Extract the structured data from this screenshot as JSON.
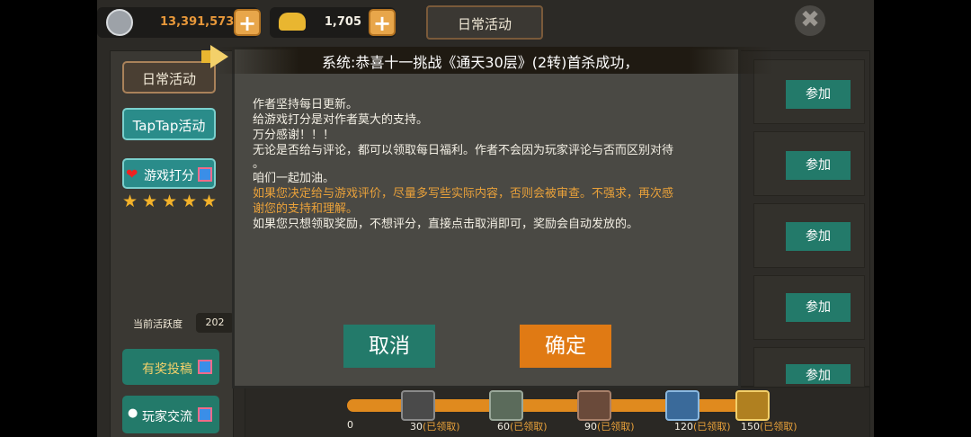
{
  "top_bar": {
    "silver": "13,391,573",
    "gold": "1,705",
    "tab_title": "日常活动",
    "plus_label": "+",
    "close_label": "✖"
  },
  "sidebar": {
    "daily": "日常活动",
    "taptap": "TapTap活动",
    "rate": "游戏打分",
    "stars": 5,
    "activity_label": "当前活跃度",
    "activity_value": "202",
    "submit": "有奖投稿",
    "community": "玩家交流"
  },
  "list": {
    "join_label": "参加"
  },
  "banner": {
    "text": "系统:恭喜十一挑战《通天30层》(2转)首杀成功，"
  },
  "dialog": {
    "lines": [
      "作者坚持每日更新。",
      "给游戏打分是对作者莫大的支持。",
      "万分感谢！！！",
      "无论是否给与评论，都可以领取每日福利。作者不会因为玩家评论与否而区别对待",
      "。",
      "咱们一起加油。",
      "如果您决定给与游戏评价，尽量多写些实际内容，否则会被审查。不强求，再次感",
      "谢您的支持和理解。",
      "如果您只想领取奖励，不想评分，直接点击取消即可，奖励会自动发放的。"
    ],
    "cancel": "取消",
    "confirm": "确定"
  },
  "progress": {
    "start": "0",
    "received": "(已领取)",
    "milestones": [
      "30",
      "60",
      "90",
      "120",
      "150"
    ]
  },
  "colors": {
    "accent_orange": "#e08a1e",
    "teal_button": "#237a6a",
    "gold_number": "#e8983a"
  }
}
